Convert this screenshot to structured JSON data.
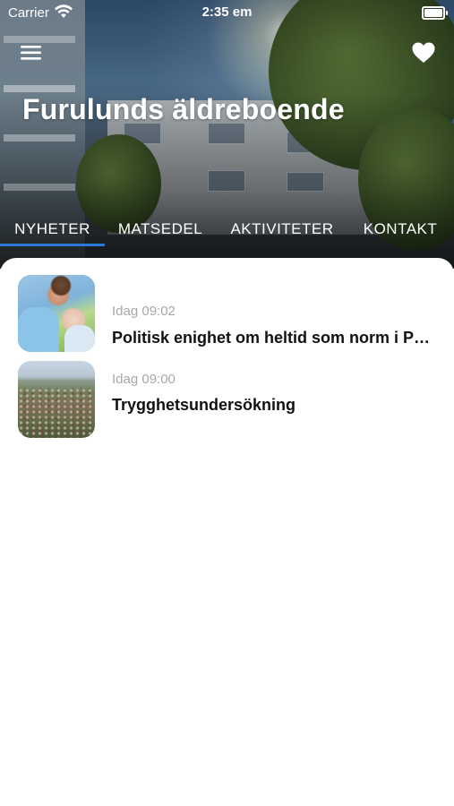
{
  "status_bar": {
    "carrier": "Carrier",
    "time": "2:35 em"
  },
  "header": {
    "title": "Furulunds äldreboende",
    "menu_icon": "hamburger-menu-icon",
    "favorite_icon": "heart-icon"
  },
  "tabs": [
    {
      "label": "NYHETER",
      "active": true
    },
    {
      "label": "MATSEDEL",
      "active": false
    },
    {
      "label": "AKTIVITETER",
      "active": false
    },
    {
      "label": "KONTAKT",
      "active": false
    }
  ],
  "colors": {
    "accent": "#2a7bd8",
    "time_text": "#a8a8a8",
    "headline_text": "#111111"
  },
  "news": [
    {
      "time": "Idag 09:02",
      "headline": "Politisk enighet om heltid som norm i Partille"
    },
    {
      "time": "Idag 09:00",
      "headline": "Trygghetsundersökning"
    }
  ]
}
